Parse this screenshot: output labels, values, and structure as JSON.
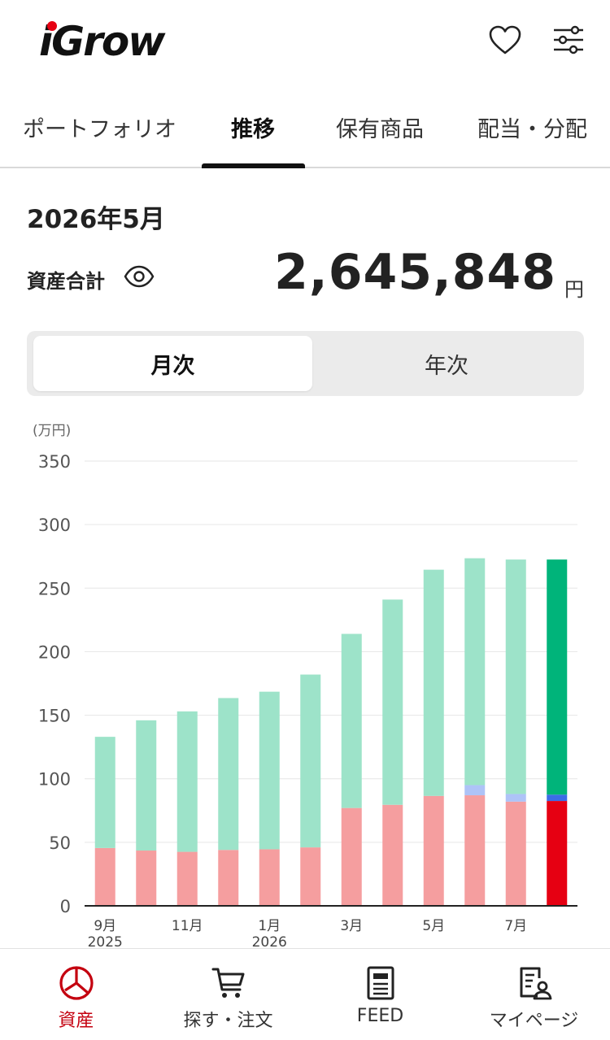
{
  "header": {
    "logo_text": "iGrow",
    "favorite_icon": "heart-icon",
    "settings_icon": "sliders-icon"
  },
  "tabs": [
    {
      "label": "ポートフォリオ",
      "active": false
    },
    {
      "label": "推移",
      "active": true
    },
    {
      "label": "保有商品",
      "active": false
    },
    {
      "label": "配当・分配",
      "active": false
    }
  ],
  "summary": {
    "month": "2026年5月",
    "total_label": "資産合計",
    "total_value": "2,645,848",
    "unit": "円"
  },
  "segment": {
    "options": [
      "月次",
      "年次"
    ],
    "selected": "月次"
  },
  "colors": {
    "brand_red": "#e60012",
    "active_nav": "#c4000f",
    "green_light": "#9de3c9",
    "green_dark": "#00b47a",
    "red_light": "#f59e9f",
    "red_dark": "#e60012",
    "blue_light": "#aec3f7",
    "blue_dark": "#3b6de6"
  },
  "chart_data": {
    "type": "bar",
    "stacked": true,
    "ylabel": "(万円)",
    "ylim": [
      0,
      350
    ],
    "yticks": [
      0,
      50,
      100,
      150,
      200,
      250,
      300,
      350
    ],
    "x_tick_labels": [
      {
        "index": 0,
        "lines": [
          "9月",
          "2025"
        ]
      },
      {
        "index": 2,
        "lines": [
          "11月"
        ]
      },
      {
        "index": 4,
        "lines": [
          "1月",
          "2026"
        ]
      },
      {
        "index": 6,
        "lines": [
          "3月"
        ]
      },
      {
        "index": 8,
        "lines": [
          "5月"
        ]
      },
      {
        "index": 10,
        "lines": [
          "7月"
        ]
      }
    ],
    "categories": [
      "2025-09",
      "2025-10",
      "2025-11",
      "2025-12",
      "2026-01",
      "2026-02",
      "2026-03",
      "2026-04",
      "2026-05",
      "2026-06",
      "2026-07",
      "2026-08"
    ],
    "highlight_index": 11,
    "series": [
      {
        "values": [
          45.5,
          43.5,
          42.5,
          44,
          44.5,
          46,
          77,
          79.5,
          86.5,
          87,
          82,
          82.5
        ]
      },
      {
        "values": [
          0,
          0,
          0,
          0,
          0,
          0,
          0,
          0,
          0,
          8,
          6,
          5
        ]
      },
      {
        "values": [
          87.5,
          102.5,
          110.5,
          119.5,
          124,
          136,
          137,
          161.5,
          178,
          178.5,
          184.5,
          185
        ]
      }
    ],
    "grid": true
  },
  "bottom_nav": [
    {
      "label": "資産",
      "icon": "pie-chart-icon",
      "active": true
    },
    {
      "label": "探す・注文",
      "icon": "cart-icon",
      "active": false
    },
    {
      "label": "FEED",
      "icon": "newspaper-icon",
      "active": false
    },
    {
      "label": "マイページ",
      "icon": "user-document-icon",
      "active": false
    }
  ]
}
